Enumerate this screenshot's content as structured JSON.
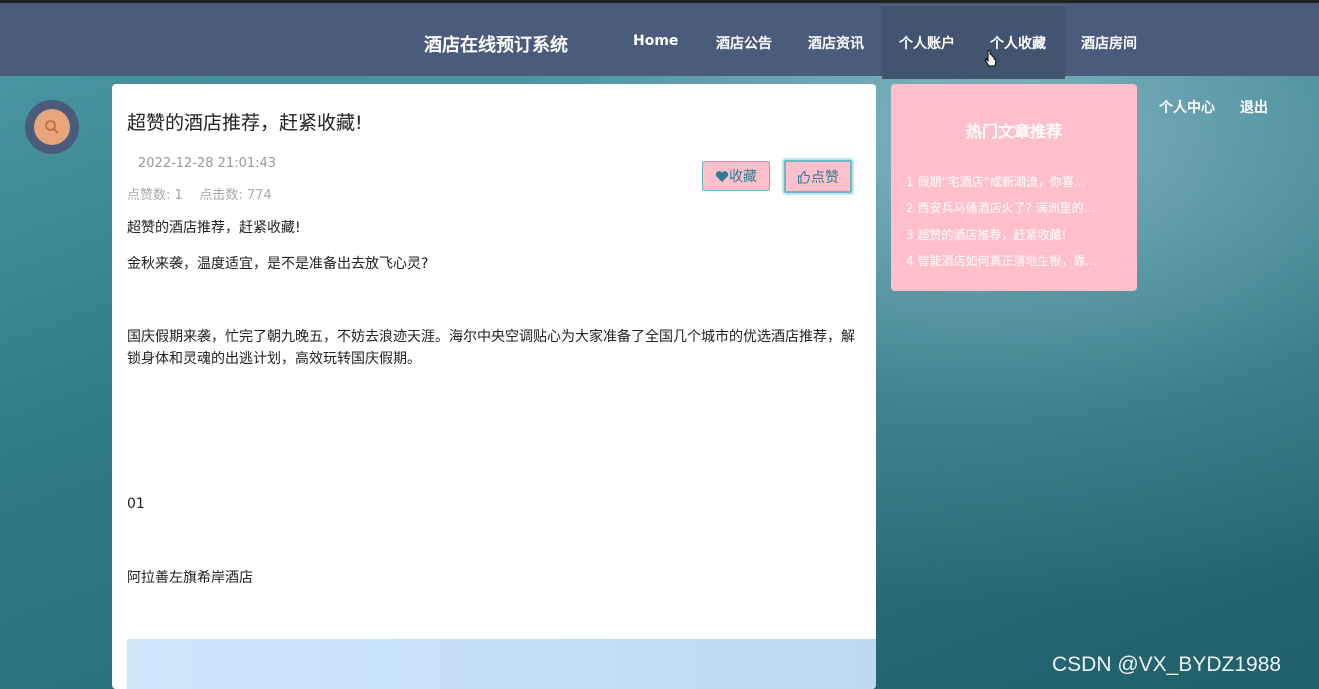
{
  "header": {
    "site_title": "酒店在线预订系统",
    "nav": [
      "Home",
      "酒店公告",
      "酒店资讯",
      "个人账户",
      "个人收藏",
      "酒店房间"
    ],
    "user_links": [
      "个人中心",
      "退出"
    ]
  },
  "article": {
    "title": "超赞的酒店推荐，赶紧收藏!",
    "date": "2022-12-28 21:01:43",
    "stats": "点赞数: 1    点击数: 774",
    "collect_label": "收藏",
    "like_label": "点赞",
    "paragraphs": [
      "超赞的酒店推荐，赶紧收藏!",
      "金秋来袭，温度适宜，是不是准备出去放飞心灵?",
      "国庆假期来袭，忙完了朝九晚五，不妨去浪迹天涯。海尔中央空调贴心为大家准备了全国几个城市的优选酒店推荐，解锁身体和灵魂的出逃计划，高效玩转国庆假期。",
      "01",
      "阿拉善左旗希岸酒店"
    ]
  },
  "hot_articles": {
    "title": "热门文章推荐",
    "items": [
      "1  假期“宅酒店”成新潮流，你喜...",
      "2  西安兵马俑酒店火了? 满洲里的...",
      "3  超赞的酒店推荐，赶紧收藏!",
      "4  智能酒店如何真正落地生根，靠..."
    ]
  },
  "watermark": "CSDN @VX_BYDZ1988",
  "colors": {
    "header": "#4a5b7c",
    "accent_pink": "#ffc0cb",
    "search_orange": "#e6a57a"
  },
  "icons": [
    "search-icon",
    "heart-icon",
    "thumb-up-icon",
    "pointer-cursor-icon"
  ]
}
